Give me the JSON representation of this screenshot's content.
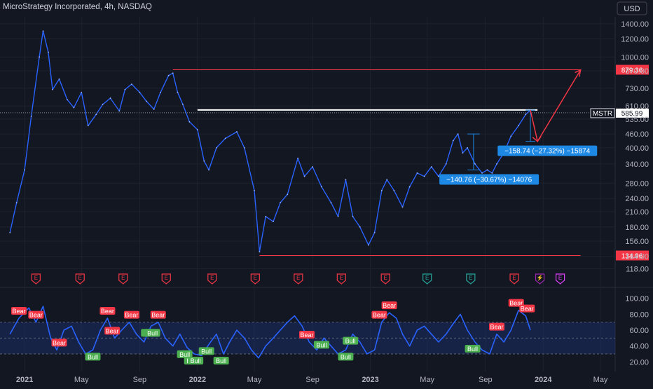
{
  "header": {
    "symbol_title": "MicroStrategy Incorporated, 4h, NASDAQ",
    "currency_button": "USD"
  },
  "colors": {
    "background": "#131722",
    "price_line": "#2962ff",
    "grid": "#1e222d",
    "axis_text": "#b2b5be",
    "red_level": "#f23645",
    "white_level": "#ffffff",
    "rsi_line": "#2962ff",
    "rsi_band": "#1e3a8a",
    "bear_label": "#f23645",
    "bull_label": "#4caf50",
    "measure_box": "#1e88e5"
  },
  "chart_data": [
    {
      "type": "line",
      "title": "MicroStrategy Incorporated, 4h, NASDAQ",
      "ylabel": "USD",
      "y_scale": "log",
      "ylim": [
        105,
        1500
      ],
      "y_ticks": [
        1400,
        1200,
        1000,
        870,
        730,
        610,
        535,
        460,
        400,
        340,
        280,
        240,
        210,
        180,
        156,
        134,
        118
      ],
      "y_tick_labels": [
        "1400.00",
        "1200.00",
        "1000.00",
        "870.00",
        "730.00",
        "610.00",
        "535.00",
        "460.00",
        "400.00",
        "340.00",
        "280.00",
        "240.00",
        "210.00",
        "180.00",
        "156.00",
        "134.00",
        "118.00"
      ],
      "x_ticks": [
        {
          "label": "2021",
          "date": "2021-01-01"
        },
        {
          "label": "May",
          "date": "2021-05-01"
        },
        {
          "label": "Sep",
          "date": "2021-09-01"
        },
        {
          "label": "2022",
          "date": "2022-01-01"
        },
        {
          "label": "May",
          "date": "2022-05-01"
        },
        {
          "label": "Sep",
          "date": "2022-09-01"
        },
        {
          "label": "2023",
          "date": "2023-01-01"
        },
        {
          "label": "May",
          "date": "2023-05-01"
        },
        {
          "label": "Sep",
          "date": "2023-09-01"
        },
        {
          "label": "2024",
          "date": "2024-01-01"
        },
        {
          "label": "May",
          "date": "2024-05-01"
        }
      ],
      "series": [
        {
          "x": [
            "2020-12-01",
            "2020-12-15",
            "2021-01-01",
            "2021-01-15",
            "2021-02-01",
            "2021-02-09",
            "2021-02-20",
            "2021-03-01",
            "2021-03-15",
            "2021-04-01",
            "2021-04-15",
            "2021-05-01",
            "2021-05-15",
            "2021-06-01",
            "2021-06-15",
            "2021-07-01",
            "2021-07-20",
            "2021-08-01",
            "2021-08-15",
            "2021-09-01",
            "2021-09-15",
            "2021-10-01",
            "2021-10-15",
            "2021-11-01",
            "2021-11-10",
            "2021-11-20",
            "2021-12-01",
            "2021-12-15",
            "2022-01-01",
            "2022-01-15",
            "2022-01-25",
            "2022-02-10",
            "2022-03-01",
            "2022-03-25",
            "2022-04-10",
            "2022-05-01",
            "2022-05-12",
            "2022-05-25",
            "2022-06-10",
            "2022-06-25",
            "2022-07-10",
            "2022-08-01",
            "2022-08-15",
            "2022-09-01",
            "2022-09-20",
            "2022-10-10",
            "2022-10-25",
            "2022-11-10",
            "2022-11-25",
            "2022-12-10",
            "2022-12-28",
            "2023-01-10",
            "2023-01-25",
            "2023-02-05",
            "2023-02-20",
            "2023-03-10",
            "2023-03-25",
            "2023-04-10",
            "2023-04-25",
            "2023-05-10",
            "2023-05-25",
            "2023-06-10",
            "2023-06-25",
            "2023-07-05",
            "2023-07-15",
            "2023-07-25",
            "2023-08-10",
            "2023-08-25",
            "2023-09-05",
            "2023-09-15",
            "2023-09-25",
            "2023-10-10",
            "2023-10-25",
            "2023-11-10",
            "2023-11-25",
            "2023-12-05"
          ],
          "y": [
            170,
            230,
            320,
            550,
            1000,
            1300,
            1050,
            720,
            800,
            650,
            600,
            700,
            500,
            560,
            620,
            660,
            580,
            720,
            760,
            700,
            640,
            590,
            700,
            830,
            850,
            700,
            620,
            520,
            480,
            350,
            320,
            400,
            440,
            470,
            400,
            260,
            140,
            200,
            190,
            230,
            250,
            360,
            300,
            330,
            270,
            230,
            200,
            290,
            200,
            180,
            150,
            170,
            260,
            290,
            260,
            220,
            270,
            310,
            300,
            330,
            300,
            340,
            430,
            460,
            380,
            400,
            340,
            310,
            320,
            310,
            340,
            380,
            450,
            500,
            560,
            585
          ]
        }
      ],
      "annotations": [
        {
          "kind": "horizontal_level",
          "value": 879.36,
          "label": "879.36",
          "from": "2021-11-10",
          "to": "2024-03-20"
        },
        {
          "kind": "horizontal_level",
          "value": 585.99,
          "label": "585.99",
          "name": "MSTR",
          "from": "2022-01-01",
          "to": "2023-12-20"
        },
        {
          "kind": "horizontal_level",
          "value": 134.96,
          "label": "134.96",
          "from": "2022-05-12",
          "to": "2024-03-20"
        },
        {
          "kind": "measure",
          "label": "−140.76 (−30.67%) −14076",
          "from": "2023-07-25",
          "to": "2023-08-20",
          "start": 460,
          "end": 320
        },
        {
          "kind": "measure",
          "label": "−158.74 (−27.32%) −15874",
          "from": "2023-11-25",
          "to": "2023-12-15",
          "start": 585,
          "end": 427
        },
        {
          "kind": "projection_arrow",
          "points": [
            [
              "2023-12-05",
              585
            ],
            [
              "2023-12-20",
              427
            ],
            [
              "2024-03-20",
              879
            ]
          ]
        }
      ],
      "events": [
        {
          "date": "2021-01-25",
          "type": "E",
          "color": "#f23645"
        },
        {
          "date": "2021-04-28",
          "type": "E",
          "color": "#f23645"
        },
        {
          "date": "2021-07-28",
          "type": "E",
          "color": "#f23645"
        },
        {
          "date": "2021-10-27",
          "type": "E",
          "color": "#f23645"
        },
        {
          "date": "2022-02-01",
          "type": "E",
          "color": "#f23645"
        },
        {
          "date": "2022-05-03",
          "type": "E",
          "color": "#f23645"
        },
        {
          "date": "2022-08-02",
          "type": "E",
          "color": "#f23645"
        },
        {
          "date": "2022-11-01",
          "type": "E",
          "color": "#f23645"
        },
        {
          "date": "2023-02-02",
          "type": "E",
          "color": "#f23645"
        },
        {
          "date": "2023-05-01",
          "type": "E",
          "color": "#26a69a"
        },
        {
          "date": "2023-08-01",
          "type": "E",
          "color": "#26a69a"
        },
        {
          "date": "2023-11-01",
          "type": "E",
          "color": "#f23645"
        },
        {
          "date": "2023-12-25",
          "type": "⚡",
          "color": "#9c27b0"
        },
        {
          "date": "2024-02-06",
          "type": "E",
          "color": "#e040fb"
        }
      ]
    },
    {
      "type": "line",
      "title": "",
      "ylim": [
        15,
        105
      ],
      "y_ticks": [
        100,
        80,
        60,
        40,
        20
      ],
      "y_tick_labels": [
        "100.00",
        "80.00",
        "60.00",
        "40.00",
        "20.00"
      ],
      "band": [
        30,
        70
      ],
      "series": [
        {
          "x": [
            "2020-12-01",
            "2020-12-20",
            "2021-01-10",
            "2021-01-25",
            "2021-02-09",
            "2021-02-25",
            "2021-03-10",
            "2021-03-25",
            "2021-04-10",
            "2021-04-25",
            "2021-05-10",
            "2021-05-25",
            "2021-06-10",
            "2021-06-25",
            "2021-07-10",
            "2021-07-25",
            "2021-08-10",
            "2021-08-25",
            "2021-09-10",
            "2021-09-25",
            "2021-10-10",
            "2021-10-25",
            "2021-11-10",
            "2021-11-25",
            "2021-12-10",
            "2021-12-25",
            "2022-01-10",
            "2022-01-25",
            "2022-02-10",
            "2022-02-25",
            "2022-03-10",
            "2022-03-25",
            "2022-04-10",
            "2022-04-25",
            "2022-05-10",
            "2022-05-25",
            "2022-06-10",
            "2022-06-25",
            "2022-07-10",
            "2022-07-25",
            "2022-08-10",
            "2022-08-25",
            "2022-09-10",
            "2022-09-25",
            "2022-10-10",
            "2022-10-25",
            "2022-11-10",
            "2022-11-25",
            "2022-12-10",
            "2022-12-25",
            "2023-01-10",
            "2023-01-25",
            "2023-02-10",
            "2023-02-25",
            "2023-03-10",
            "2023-03-25",
            "2023-04-10",
            "2023-04-25",
            "2023-05-10",
            "2023-05-25",
            "2023-06-10",
            "2023-06-25",
            "2023-07-10",
            "2023-07-25",
            "2023-08-10",
            "2023-08-25",
            "2023-09-10",
            "2023-09-25",
            "2023-10-10",
            "2023-10-25",
            "2023-11-10",
            "2023-11-25",
            "2023-12-05"
          ],
          "y": [
            55,
            75,
            88,
            70,
            90,
            50,
            35,
            60,
            65,
            45,
            30,
            35,
            60,
            75,
            50,
            60,
            70,
            55,
            45,
            65,
            70,
            50,
            40,
            55,
            38,
            30,
            28,
            42,
            55,
            30,
            45,
            60,
            50,
            35,
            25,
            40,
            50,
            60,
            70,
            78,
            65,
            45,
            35,
            50,
            40,
            30,
            35,
            55,
            45,
            30,
            35,
            70,
            82,
            75,
            55,
            40,
            60,
            65,
            55,
            45,
            55,
            68,
            80,
            60,
            45,
            35,
            30,
            55,
            45,
            60,
            85,
            78,
            60
          ]
        }
      ],
      "signals": [
        {
          "date": "2020-12-20",
          "label": "Bear"
        },
        {
          "date": "2021-01-25",
          "label": "Bear"
        },
        {
          "date": "2021-03-15",
          "label": "Bear"
        },
        {
          "date": "2021-05-25",
          "label": "Bull"
        },
        {
          "date": "2021-06-25",
          "label": "Bear"
        },
        {
          "date": "2021-07-05",
          "label": "Bear"
        },
        {
          "date": "2021-08-15",
          "label": "Bear"
        },
        {
          "date": "2021-09-20",
          "label": "Bull"
        },
        {
          "date": "2021-09-25",
          "label": "Bull"
        },
        {
          "date": "2021-09-28",
          "label": "Bull"
        },
        {
          "date": "2021-10-10",
          "label": "Bear"
        },
        {
          "date": "2021-12-05",
          "label": "Bull"
        },
        {
          "date": "2021-12-20",
          "label": "Bull"
        },
        {
          "date": "2021-12-28",
          "label": "Bull"
        },
        {
          "date": "2022-01-20",
          "label": "Bull"
        },
        {
          "date": "2022-02-20",
          "label": "Bull"
        },
        {
          "date": "2022-08-20",
          "label": "Bear"
        },
        {
          "date": "2022-09-20",
          "label": "Bull"
        },
        {
          "date": "2022-11-10",
          "label": "Bull"
        },
        {
          "date": "2022-11-20",
          "label": "Bull"
        },
        {
          "date": "2023-01-20",
          "label": "Bear"
        },
        {
          "date": "2023-02-10",
          "label": "Bear"
        },
        {
          "date": "2023-08-05",
          "label": "Bull"
        },
        {
          "date": "2023-09-25",
          "label": "Bear"
        },
        {
          "date": "2023-11-05",
          "label": "Bear"
        },
        {
          "date": "2023-11-28",
          "label": "Bear"
        }
      ]
    }
  ]
}
